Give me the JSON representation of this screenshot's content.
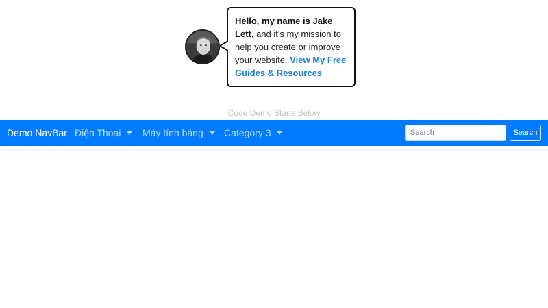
{
  "intro": {
    "greeting_bold": "Hello, my name is Jake Lett,",
    "greeting_rest": " and it's my mission to help you create or improve your website. ",
    "link_text": "View My Free Guides & Resources"
  },
  "demo_label": "Code Demo Starts Below",
  "navbar": {
    "brand": "Demo NavBar",
    "items": [
      {
        "label": "Điện Thoại"
      },
      {
        "label": "Máy tính bảng"
      },
      {
        "label": "Category 3"
      }
    ],
    "search": {
      "placeholder": "Search",
      "button_label": "Search"
    },
    "color": "#007bff"
  }
}
